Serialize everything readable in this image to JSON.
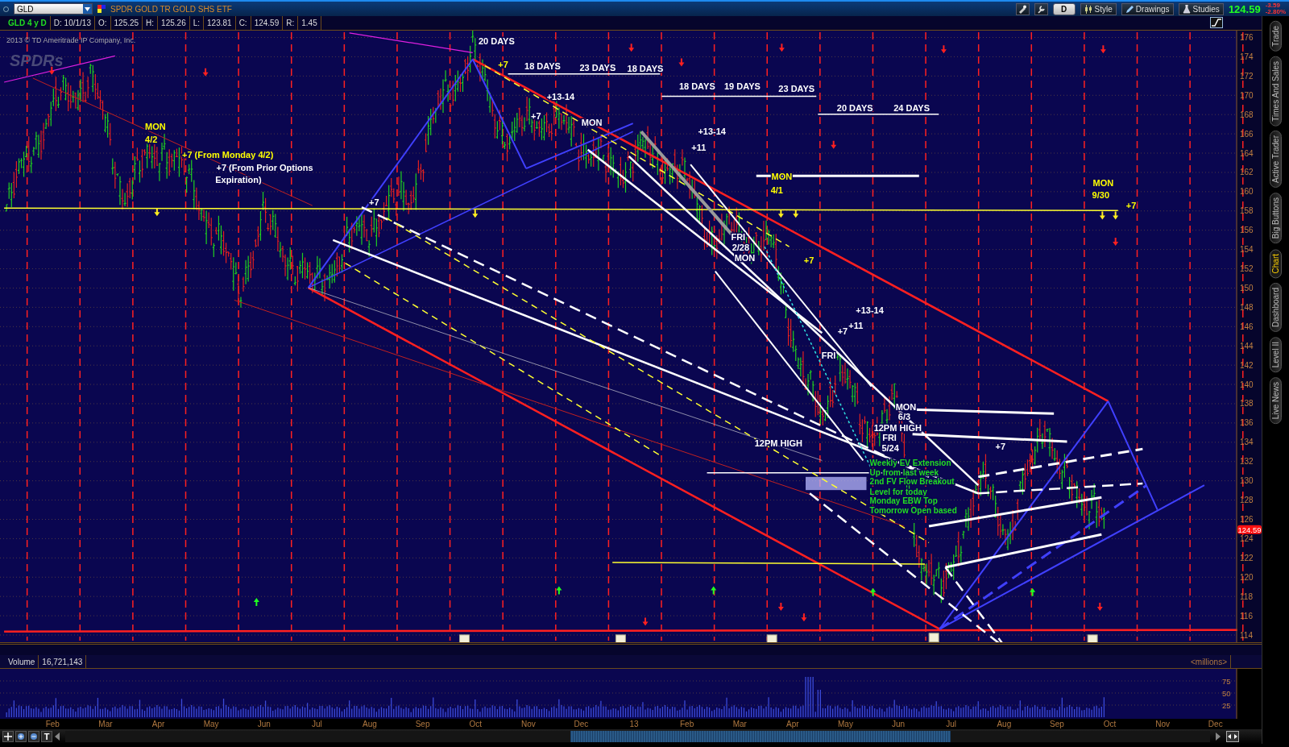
{
  "header": {
    "symbol": "GLD",
    "description": "SPDR GOLD TR GOLD SHS ETF",
    "period_button": "D",
    "buttons": [
      "Style",
      "Drawings",
      "Studies"
    ],
    "last_price": "124.59",
    "change": "-3.59",
    "change_percent": "-2.80%"
  },
  "info_bar": {
    "label": "GLD 4 y D",
    "date": "D: 10/1/13",
    "fields": [
      {
        "name": "O:",
        "value": "125.25"
      },
      {
        "name": "H:",
        "value": "125.26"
      },
      {
        "name": "L:",
        "value": "123.81"
      },
      {
        "name": "C:",
        "value": "124.59"
      },
      {
        "name": "R:",
        "value": "1.45"
      }
    ]
  },
  "chart": {
    "copyright": "2013 © TD Ameritrade IP Company, Inc.",
    "logo": "SPDRs",
    "price_tag": "124.59",
    "price_axis": [
      "176",
      "174",
      "172",
      "170",
      "168",
      "166",
      "164",
      "162",
      "160",
      "158",
      "156",
      "154",
      "152",
      "150",
      "148",
      "146",
      "144",
      "142",
      "140",
      "138",
      "136",
      "134",
      "132",
      "130",
      "128",
      "126",
      "124",
      "122",
      "120",
      "118",
      "116",
      "114"
    ],
    "annotations": [
      {
        "text": "20 DAYS",
        "color": "#ffffff"
      },
      {
        "text": "+7",
        "color": "#ffff00"
      },
      {
        "text": "18 DAYS",
        "color": "#ffffff"
      },
      {
        "text": "23 DAYS",
        "color": "#ffffff"
      },
      {
        "text": "18 DAYS",
        "color": "#ffffff"
      },
      {
        "text": "+13-14",
        "color": "#ffffff"
      },
      {
        "text": "+7",
        "color": "#ffffff"
      },
      {
        "text": "MON",
        "color": "#ffffff"
      },
      {
        "text": "18 DAYS",
        "color": "#ffffff"
      },
      {
        "text": "19 DAYS",
        "color": "#ffffff"
      },
      {
        "text": "23 DAYS",
        "color": "#ffffff"
      },
      {
        "text": "20 DAYS",
        "color": "#ffffff"
      },
      {
        "text": "24 DAYS",
        "color": "#ffffff"
      },
      {
        "text": "+13-14",
        "color": "#ffffff"
      },
      {
        "text": "+11",
        "color": "#ffffff"
      },
      {
        "text": "MON",
        "color": "#ffff00"
      },
      {
        "text": "4/2",
        "color": "#ffff00"
      },
      {
        "text": "+7 (From Monday 4/2)",
        "color": "#ffff00"
      },
      {
        "text": "+7 (From Prior Options",
        "color": "#ffffff"
      },
      {
        "text": "Expiration)",
        "color": "#ffffff"
      },
      {
        "text": "+7",
        "color": "#ffffff"
      },
      {
        "text": "MON",
        "color": "#ffff00"
      },
      {
        "text": "4/1",
        "color": "#ffff00"
      },
      {
        "text": "MON",
        "color": "#ffff00"
      },
      {
        "text": "9/30",
        "color": "#ffff00"
      },
      {
        "text": "+7",
        "color": "#ffff00"
      },
      {
        "text": "FRI",
        "color": "#ffffff"
      },
      {
        "text": "2/28",
        "color": "#ffffff"
      },
      {
        "text": "MON",
        "color": "#ffffff"
      },
      {
        "text": "+7",
        "color": "#ffff00"
      },
      {
        "text": "+13-14",
        "color": "#ffffff"
      },
      {
        "text": "+11",
        "color": "#ffffff"
      },
      {
        "text": "+7",
        "color": "#ffffff"
      },
      {
        "text": "FRI",
        "color": "#ffffff"
      },
      {
        "text": "MON",
        "color": "#ffffff"
      },
      {
        "text": "6/3",
        "color": "#ffffff"
      },
      {
        "text": "12PM HIGH",
        "color": "#ffffff"
      },
      {
        "text": "FRI",
        "color": "#ffffff"
      },
      {
        "text": "5/24",
        "color": "#ffffff"
      },
      {
        "text": "12PM HIGH",
        "color": "#ffffff"
      },
      {
        "text": "+7",
        "color": "#ffffff"
      },
      {
        "text": "Weekly EV Extension",
        "color": "#22dd22"
      },
      {
        "text": "Up from last week",
        "color": "#22dd22"
      },
      {
        "text": "2nd FV Flow Breakout",
        "color": "#22dd22"
      },
      {
        "text": "Level for today",
        "color": "#22dd22"
      },
      {
        "text": "Monday EBW Top",
        "color": "#22dd22"
      },
      {
        "text": "Tomorrow Open based",
        "color": "#22dd22"
      }
    ]
  },
  "volume": {
    "title": "Volume",
    "value": "16,721,143",
    "unit": "<millions>",
    "axis": [
      "75",
      "50",
      "25"
    ]
  },
  "months": [
    "Feb",
    "Mar",
    "Apr",
    "May",
    "Jun",
    "Jul",
    "Aug",
    "Sep",
    "Oct",
    "Nov",
    "Dec",
    "13",
    "Feb",
    "Mar",
    "Apr",
    "May",
    "Jun",
    "Jul",
    "Aug",
    "Sep",
    "Oct",
    "Nov",
    "Dec"
  ],
  "toolbar": {
    "text_tool": "T"
  },
  "side_tabs": [
    {
      "label": "Trade",
      "selected": false
    },
    {
      "label": "Times And Sales",
      "selected": false
    },
    {
      "label": "Active Trader",
      "selected": false
    },
    {
      "label": "Big Buttons",
      "selected": false
    },
    {
      "label": "Chart",
      "selected": true
    },
    {
      "label": "Dashboard",
      "selected": false
    },
    {
      "label": "Level II",
      "selected": false
    },
    {
      "label": "Live News",
      "selected": false
    }
  ]
}
